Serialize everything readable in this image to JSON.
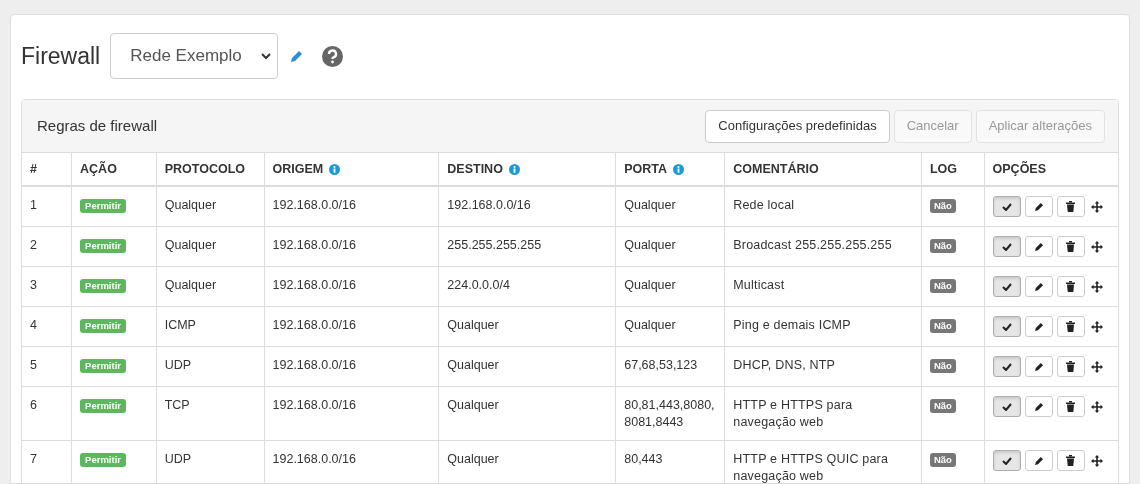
{
  "title": "Firewall",
  "network_select": {
    "value": "Rede Exemplo"
  },
  "panel": {
    "title": "Regras de firewall",
    "buttons": [
      {
        "label": "Configurações predefinidas",
        "disabled": false
      },
      {
        "label": "Cancelar",
        "disabled": true
      },
      {
        "label": "Aplicar alterações",
        "disabled": true
      }
    ]
  },
  "table": {
    "columns": [
      {
        "label": "#",
        "info": false
      },
      {
        "label": "AÇÃO",
        "info": false
      },
      {
        "label": "PROTOCOLO",
        "info": false
      },
      {
        "label": "ORIGEM",
        "info": true
      },
      {
        "label": "DESTINO",
        "info": true
      },
      {
        "label": "PORTA",
        "info": true
      },
      {
        "label": "COMENTÁRIO",
        "info": false
      },
      {
        "label": "LOG",
        "info": false
      },
      {
        "label": "OPÇÕES",
        "info": false
      }
    ],
    "rows": [
      {
        "number": "1",
        "action": "Permitir",
        "protocol": "Qualquer",
        "source": "192.168.0.0/16",
        "destination": "192.168.0.0/16",
        "port": "Qualquer",
        "comment": "Rede local",
        "log": "Não",
        "enabled": true
      },
      {
        "number": "2",
        "action": "Permitir",
        "protocol": "Qualquer",
        "source": "192.168.0.0/16",
        "destination": "255.255.255.255",
        "port": "Qualquer",
        "comment": "Broadcast 255.255.255.255",
        "log": "Não",
        "enabled": true
      },
      {
        "number": "3",
        "action": "Permitir",
        "protocol": "Qualquer",
        "source": "192.168.0.0/16",
        "destination": "224.0.0.0/4",
        "port": "Qualquer",
        "comment": "Multicast",
        "log": "Não",
        "enabled": true
      },
      {
        "number": "4",
        "action": "Permitir",
        "protocol": "ICMP",
        "source": "192.168.0.0/16",
        "destination": "Qualquer",
        "port": "Qualquer",
        "comment": "Ping e demais ICMP",
        "log": "Não",
        "enabled": true
      },
      {
        "number": "5",
        "action": "Permitir",
        "protocol": "UDP",
        "source": "192.168.0.0/16",
        "destination": "Qualquer",
        "port": "67,68,53,123",
        "comment": "DHCP, DNS, NTP",
        "log": "Não",
        "enabled": true
      },
      {
        "number": "6",
        "action": "Permitir",
        "protocol": "TCP",
        "source": "192.168.0.0/16",
        "destination": "Qualquer",
        "port": "80,81,443,8080,8081,8443",
        "comment": "HTTP e HTTPS para navegação web",
        "log": "Não",
        "enabled": true
      },
      {
        "number": "7",
        "action": "Permitir",
        "protocol": "UDP",
        "source": "192.168.0.0/16",
        "destination": "Qualquer",
        "port": "80,443",
        "comment": "HTTP e HTTPS QUIC para navegação web",
        "log": "Não",
        "enabled": true
      }
    ]
  }
}
